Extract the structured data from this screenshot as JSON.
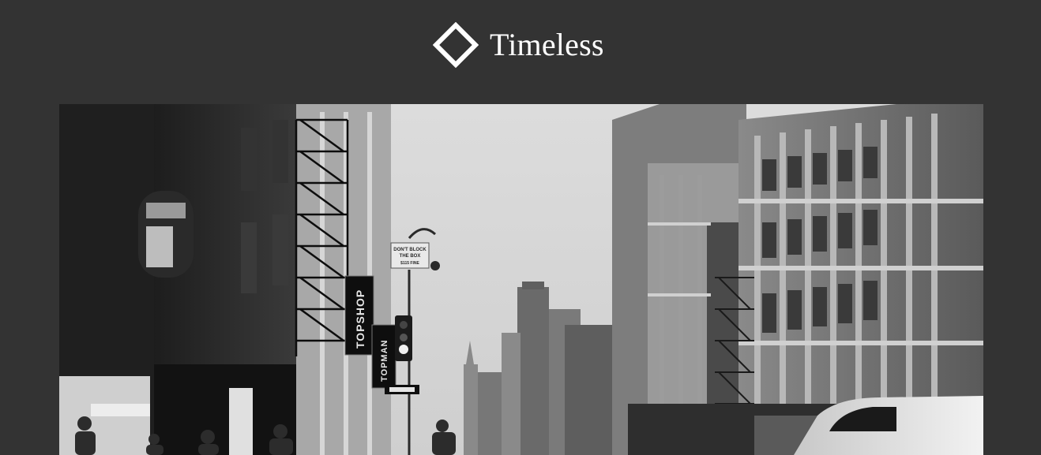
{
  "header": {
    "logo_icon": "diamond-outline-icon",
    "brand_name": "Timeless"
  },
  "hero": {
    "image_subject": "black-and-white-city-street",
    "signs": {
      "topshop": "TOPSHOP",
      "topman": "TOPMAN",
      "dont_block_line1": "DON'T BLOCK",
      "dont_block_line2": "THE BOX",
      "dont_block_line3": "$115 FINE"
    }
  },
  "colors": {
    "header_bg": "#333333",
    "text": "#ffffff"
  }
}
